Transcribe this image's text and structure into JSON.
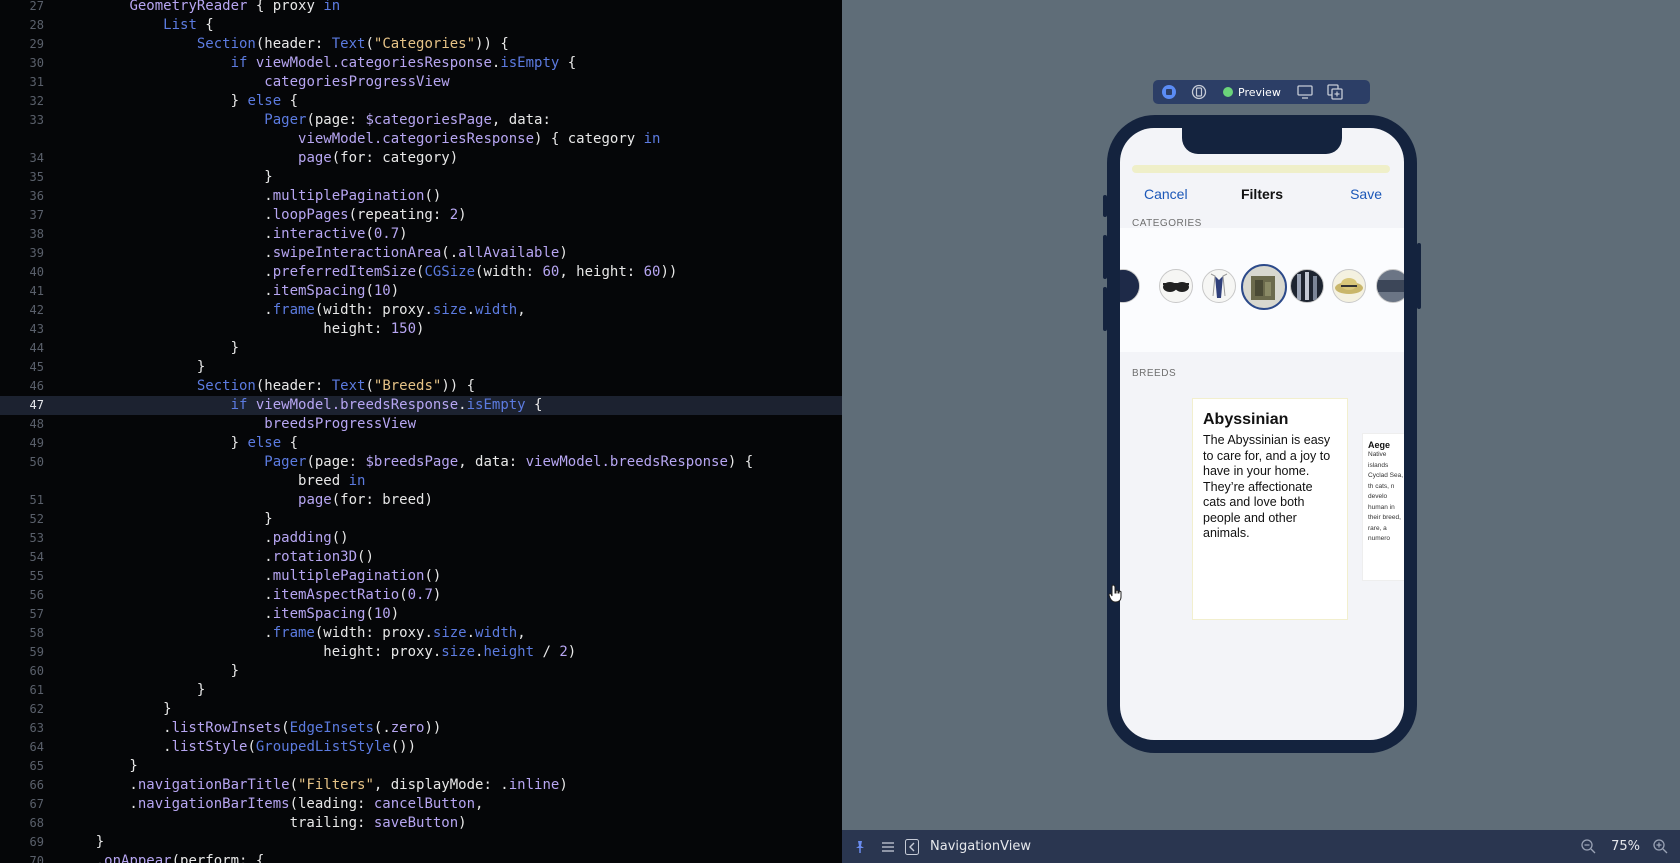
{
  "editor": {
    "current_line": "47",
    "lines": [
      {
        "no": "27",
        "seg": [
          [
            "pl",
            "        "
          ],
          [
            "nm",
            "GeometryReader"
          ],
          [
            "pl",
            " { proxy "
          ],
          [
            "kw",
            "in"
          ]
        ]
      },
      {
        "no": "28",
        "seg": [
          [
            "pl",
            "            "
          ],
          [
            "kw",
            "List"
          ],
          [
            "pl",
            " {"
          ]
        ]
      },
      {
        "no": "29",
        "seg": [
          [
            "pl",
            "                "
          ],
          [
            "kw",
            "Section"
          ],
          [
            "pl",
            "(header: "
          ],
          [
            "kw",
            "Text"
          ],
          [
            "pl",
            "("
          ],
          [
            "st",
            "\"Categories\""
          ],
          [
            "pl",
            ")) {"
          ]
        ]
      },
      {
        "no": "30",
        "seg": [
          [
            "pl",
            "                    "
          ],
          [
            "kw",
            "if"
          ],
          [
            "pl",
            " "
          ],
          [
            "nm",
            "viewModel.categoriesResponse"
          ],
          [
            "pl",
            "."
          ],
          [
            "kw",
            "isEmpty"
          ],
          [
            "pl",
            " {"
          ]
        ]
      },
      {
        "no": "31",
        "seg": [
          [
            "pl",
            "                        "
          ],
          [
            "nm",
            "categoriesProgressView"
          ]
        ]
      },
      {
        "no": "32",
        "seg": [
          [
            "pl",
            "                    } "
          ],
          [
            "kw",
            "else"
          ],
          [
            "pl",
            " {"
          ]
        ]
      },
      {
        "no": "33",
        "seg": [
          [
            "pl",
            "                        "
          ],
          [
            "kw",
            "Pager"
          ],
          [
            "pl",
            "(page: "
          ],
          [
            "nm",
            "$categoriesPage"
          ],
          [
            "pl",
            ", data:"
          ]
        ]
      },
      {
        "no": "",
        "seg": [
          [
            "pl",
            "                            "
          ],
          [
            "nm",
            "viewModel.categoriesResponse"
          ],
          [
            "pl",
            ") { category "
          ],
          [
            "kw",
            "in"
          ]
        ]
      },
      {
        "no": "34",
        "seg": [
          [
            "pl",
            "                            "
          ],
          [
            "nm",
            "page"
          ],
          [
            "pl",
            "(for: category)"
          ]
        ]
      },
      {
        "no": "35",
        "seg": [
          [
            "pl",
            "                        }"
          ]
        ]
      },
      {
        "no": "36",
        "seg": [
          [
            "pl",
            "                        ."
          ],
          [
            "nm",
            "multiplePagination"
          ],
          [
            "pl",
            "()"
          ]
        ]
      },
      {
        "no": "37",
        "seg": [
          [
            "pl",
            "                        ."
          ],
          [
            "nm",
            "loopPages"
          ],
          [
            "pl",
            "(repeating: "
          ],
          [
            "nm",
            "2"
          ],
          [
            "pl",
            ")"
          ]
        ]
      },
      {
        "no": "38",
        "seg": [
          [
            "pl",
            "                        ."
          ],
          [
            "nm",
            "interactive"
          ],
          [
            "pl",
            "("
          ],
          [
            "nm",
            "0.7"
          ],
          [
            "pl",
            ")"
          ]
        ]
      },
      {
        "no": "39",
        "seg": [
          [
            "pl",
            "                        ."
          ],
          [
            "nm",
            "swipeInteractionArea"
          ],
          [
            "pl",
            "(."
          ],
          [
            "nm",
            "allAvailable"
          ],
          [
            "pl",
            ")"
          ]
        ]
      },
      {
        "no": "40",
        "seg": [
          [
            "pl",
            "                        ."
          ],
          [
            "nm",
            "preferredItemSize"
          ],
          [
            "pl",
            "("
          ],
          [
            "kw",
            "CGSize"
          ],
          [
            "pl",
            "(width: "
          ],
          [
            "nm",
            "60"
          ],
          [
            "pl",
            ", height: "
          ],
          [
            "nm",
            "60"
          ],
          [
            "pl",
            "))"
          ]
        ]
      },
      {
        "no": "41",
        "seg": [
          [
            "pl",
            "                        ."
          ],
          [
            "nm",
            "itemSpacing"
          ],
          [
            "pl",
            "("
          ],
          [
            "nm",
            "10"
          ],
          [
            "pl",
            ")"
          ]
        ]
      },
      {
        "no": "42",
        "seg": [
          [
            "pl",
            "                        ."
          ],
          [
            "kw",
            "frame"
          ],
          [
            "pl",
            "(width: proxy."
          ],
          [
            "kw",
            "size"
          ],
          [
            "pl",
            "."
          ],
          [
            "kw",
            "width"
          ],
          [
            "pl",
            ","
          ]
        ]
      },
      {
        "no": "43",
        "seg": [
          [
            "pl",
            "                               height: "
          ],
          [
            "nm",
            "150"
          ],
          [
            "pl",
            ")"
          ]
        ]
      },
      {
        "no": "44",
        "seg": [
          [
            "pl",
            "                    }"
          ]
        ]
      },
      {
        "no": "45",
        "seg": [
          [
            "pl",
            "                }"
          ]
        ]
      },
      {
        "no": "46",
        "seg": [
          [
            "pl",
            "                "
          ],
          [
            "kw",
            "Section"
          ],
          [
            "pl",
            "(header: "
          ],
          [
            "kw",
            "Text"
          ],
          [
            "pl",
            "("
          ],
          [
            "st",
            "\"Breeds\""
          ],
          [
            "pl",
            ")) {"
          ]
        ]
      },
      {
        "no": "47",
        "seg": [
          [
            "pl",
            "                    "
          ],
          [
            "kw",
            "if"
          ],
          [
            "pl",
            " "
          ],
          [
            "nm",
            "viewModel.breedsResponse"
          ],
          [
            "pl",
            "."
          ],
          [
            "kw",
            "isEmpty"
          ],
          [
            "pl",
            " {"
          ]
        ]
      },
      {
        "no": "48",
        "seg": [
          [
            "pl",
            "                        "
          ],
          [
            "nm",
            "breedsProgressView"
          ]
        ]
      },
      {
        "no": "49",
        "seg": [
          [
            "pl",
            "                    } "
          ],
          [
            "kw",
            "else"
          ],
          [
            "pl",
            " {"
          ]
        ]
      },
      {
        "no": "50",
        "seg": [
          [
            "pl",
            "                        "
          ],
          [
            "kw",
            "Pager"
          ],
          [
            "pl",
            "(page: "
          ],
          [
            "nm",
            "$breedsPage"
          ],
          [
            "pl",
            ", data: "
          ],
          [
            "nm",
            "viewModel.breedsResponse"
          ],
          [
            "pl",
            ") {"
          ]
        ]
      },
      {
        "no": "",
        "seg": [
          [
            "pl",
            "                            breed "
          ],
          [
            "kw",
            "in"
          ]
        ]
      },
      {
        "no": "51",
        "seg": [
          [
            "pl",
            "                            "
          ],
          [
            "nm",
            "page"
          ],
          [
            "pl",
            "(for: breed)"
          ]
        ]
      },
      {
        "no": "52",
        "seg": [
          [
            "pl",
            "                        }"
          ]
        ]
      },
      {
        "no": "53",
        "seg": [
          [
            "pl",
            "                        ."
          ],
          [
            "nm",
            "padding"
          ],
          [
            "pl",
            "()"
          ]
        ]
      },
      {
        "no": "54",
        "seg": [
          [
            "pl",
            "                        ."
          ],
          [
            "nm",
            "rotation3D"
          ],
          [
            "pl",
            "()"
          ]
        ]
      },
      {
        "no": "55",
        "seg": [
          [
            "pl",
            "                        ."
          ],
          [
            "nm",
            "multiplePagination"
          ],
          [
            "pl",
            "()"
          ]
        ]
      },
      {
        "no": "56",
        "seg": [
          [
            "pl",
            "                        ."
          ],
          [
            "nm",
            "itemAspectRatio"
          ],
          [
            "pl",
            "("
          ],
          [
            "nm",
            "0.7"
          ],
          [
            "pl",
            ")"
          ]
        ]
      },
      {
        "no": "57",
        "seg": [
          [
            "pl",
            "                        ."
          ],
          [
            "nm",
            "itemSpacing"
          ],
          [
            "pl",
            "("
          ],
          [
            "nm",
            "10"
          ],
          [
            "pl",
            ")"
          ]
        ]
      },
      {
        "no": "58",
        "seg": [
          [
            "pl",
            "                        ."
          ],
          [
            "kw",
            "frame"
          ],
          [
            "pl",
            "(width: proxy."
          ],
          [
            "kw",
            "size"
          ],
          [
            "pl",
            "."
          ],
          [
            "kw",
            "width"
          ],
          [
            "pl",
            ","
          ]
        ]
      },
      {
        "no": "59",
        "seg": [
          [
            "pl",
            "                               height: proxy."
          ],
          [
            "kw",
            "size"
          ],
          [
            "pl",
            "."
          ],
          [
            "kw",
            "height"
          ],
          [
            "pl",
            " / "
          ],
          [
            "nm",
            "2"
          ],
          [
            "pl",
            ")"
          ]
        ]
      },
      {
        "no": "60",
        "seg": [
          [
            "pl",
            "                    }"
          ]
        ]
      },
      {
        "no": "61",
        "seg": [
          [
            "pl",
            "                }"
          ]
        ]
      },
      {
        "no": "62",
        "seg": [
          [
            "pl",
            "            }"
          ]
        ]
      },
      {
        "no": "63",
        "seg": [
          [
            "pl",
            "            ."
          ],
          [
            "nm",
            "listRowInsets"
          ],
          [
            "pl",
            "("
          ],
          [
            "kw",
            "EdgeInsets"
          ],
          [
            "pl",
            "(."
          ],
          [
            "nm",
            "zero"
          ],
          [
            "pl",
            "))"
          ]
        ]
      },
      {
        "no": "64",
        "seg": [
          [
            "pl",
            "            ."
          ],
          [
            "nm",
            "listStyle"
          ],
          [
            "pl",
            "("
          ],
          [
            "kw",
            "GroupedListStyle"
          ],
          [
            "pl",
            "())"
          ]
        ]
      },
      {
        "no": "65",
        "seg": [
          [
            "pl",
            "        }"
          ]
        ]
      },
      {
        "no": "66",
        "seg": [
          [
            "pl",
            "        ."
          ],
          [
            "nm",
            "navigationBarTitle"
          ],
          [
            "pl",
            "("
          ],
          [
            "st",
            "\"Filters\""
          ],
          [
            "pl",
            ", displayMode: ."
          ],
          [
            "nm",
            "inline"
          ],
          [
            "pl",
            ")"
          ]
        ]
      },
      {
        "no": "67",
        "seg": [
          [
            "pl",
            "        ."
          ],
          [
            "nm",
            "navigationBarItems"
          ],
          [
            "pl",
            "(leading: "
          ],
          [
            "nm",
            "cancelButton"
          ],
          [
            "pl",
            ","
          ]
        ]
      },
      {
        "no": "68",
        "seg": [
          [
            "pl",
            "                           trailing: "
          ],
          [
            "nm",
            "saveButton"
          ],
          [
            "pl",
            ")"
          ]
        ]
      },
      {
        "no": "69",
        "seg": [
          [
            "pl",
            "    }"
          ]
        ]
      },
      {
        "no": "70",
        "seg": [
          [
            "pl",
            "    ."
          ],
          [
            "nm",
            "onAppear"
          ],
          [
            "pl",
            "(perform: {"
          ]
        ]
      }
    ]
  },
  "preview_toolbar": {
    "preview_label": "Preview",
    "icons": [
      "live-preview-icon",
      "inspect-icon",
      "device-settings-icon",
      "duplicate-preview-icon"
    ]
  },
  "phone": {
    "nav": {
      "cancel": "Cancel",
      "title": "Filters",
      "save": "Save"
    },
    "categories_header": "CATEGORIES",
    "breeds_header": "BREEDS",
    "breed_card": {
      "name": "Abyssinian",
      "description": "The Abyssinian is easy to care for, and a joy to have in your home. They’re affectionate cats and love both people and other animals."
    },
    "breed_card_next": {
      "name": "Aege",
      "description": "Native islands Cyclad Sea, th cats, n develo human in their breed, rare, a numero"
    }
  },
  "bottom_bar": {
    "breadcrumb": "NavigationView",
    "zoom": "75%"
  },
  "colors": {
    "editor_bg": "#050608",
    "keyword": "#5c7be0",
    "string": "#e6c387",
    "identifier": "#b7a6f2",
    "canvas_bg": "#5f6d78",
    "accent_link": "#1b57b8"
  }
}
